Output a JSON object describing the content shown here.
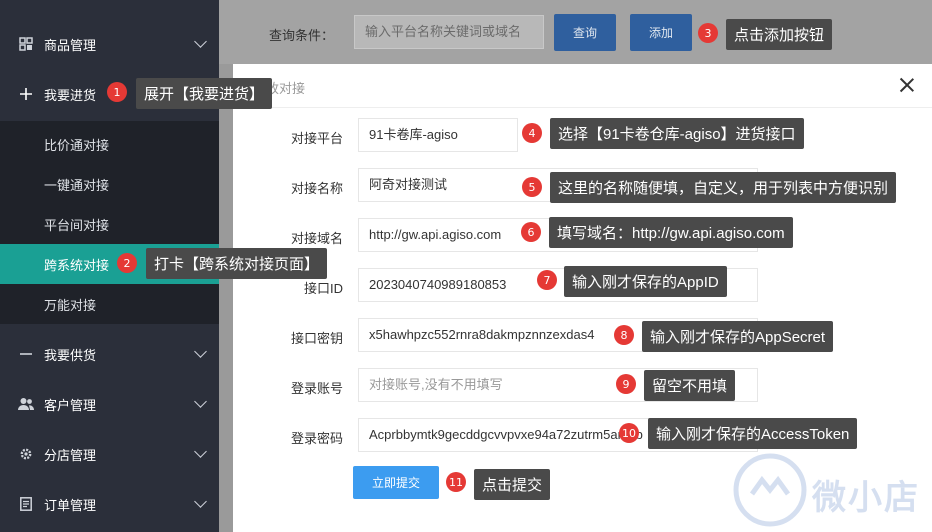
{
  "sidebar": {
    "items": [
      {
        "label": "商品管理",
        "icon": "grid-icon"
      },
      {
        "label": "我要进货",
        "icon": "plus-icon"
      },
      {
        "label": "我要供货",
        "icon": "minus-icon"
      },
      {
        "label": "客户管理",
        "icon": "users-icon"
      },
      {
        "label": "分店管理",
        "icon": "gear-icon"
      },
      {
        "label": "订单管理",
        "icon": "document-icon"
      }
    ],
    "subitems": [
      {
        "label": "比价通对接"
      },
      {
        "label": "一键通对接"
      },
      {
        "label": "平台间对接"
      },
      {
        "label": "跨系统对接",
        "active": true
      },
      {
        "label": "万能对接"
      }
    ]
  },
  "search": {
    "label": "查询条件：",
    "placeholder": "输入平台名称关键词或域名",
    "query_button": "查询",
    "add_button": "添加"
  },
  "modal": {
    "title": "修改对接",
    "fields": [
      {
        "label": "对接平台",
        "value": "91卡卷库-agiso",
        "placeholder": false
      },
      {
        "label": "对接名称",
        "value": "阿奇对接测试",
        "placeholder": false
      },
      {
        "label": "对接域名",
        "value": "http://gw.api.agiso.com",
        "placeholder": false
      },
      {
        "label": "接口ID",
        "value": "2023040740989180853",
        "placeholder": false
      },
      {
        "label": "接口密钥",
        "value": "x5hawhpzc552rnra8dakmpznnzexdas4",
        "placeholder": false
      },
      {
        "label": "登录账号",
        "value": "对接账号,没有不用填写",
        "placeholder": true
      },
      {
        "label": "登录密码",
        "value": "Acprbbymtk9gecddgcvvpvxe94a72zutrm5amhb",
        "placeholder": false
      }
    ],
    "submit_button": "立即提交"
  },
  "annotations": [
    {
      "n": "1",
      "text": "展开【我要进货】"
    },
    {
      "n": "2",
      "text": "打卡【跨系统对接页面】"
    },
    {
      "n": "3",
      "text": "点击添加按钮"
    },
    {
      "n": "4",
      "text": "选择【91卡卷仓库-agiso】进货接口"
    },
    {
      "n": "5",
      "text": "这里的名称随便填，自定义，用于列表中方便识别"
    },
    {
      "n": "6",
      "text": "填写域名：http://gw.api.agiso.com"
    },
    {
      "n": "7",
      "text": "输入刚才保存的AppID"
    },
    {
      "n": "8",
      "text": "输入刚才保存的AppSecret"
    },
    {
      "n": "9",
      "text": "留空不用填"
    },
    {
      "n": "10",
      "text": "输入刚才保存的AccessToken"
    },
    {
      "n": "11",
      "text": "点击提交"
    }
  ],
  "watermark": {
    "text": "微小店"
  },
  "colors": {
    "sidebar": "#2b2f3a",
    "active": "#1aa094",
    "primary": "#3c9cf0",
    "badge": "#e53935"
  }
}
